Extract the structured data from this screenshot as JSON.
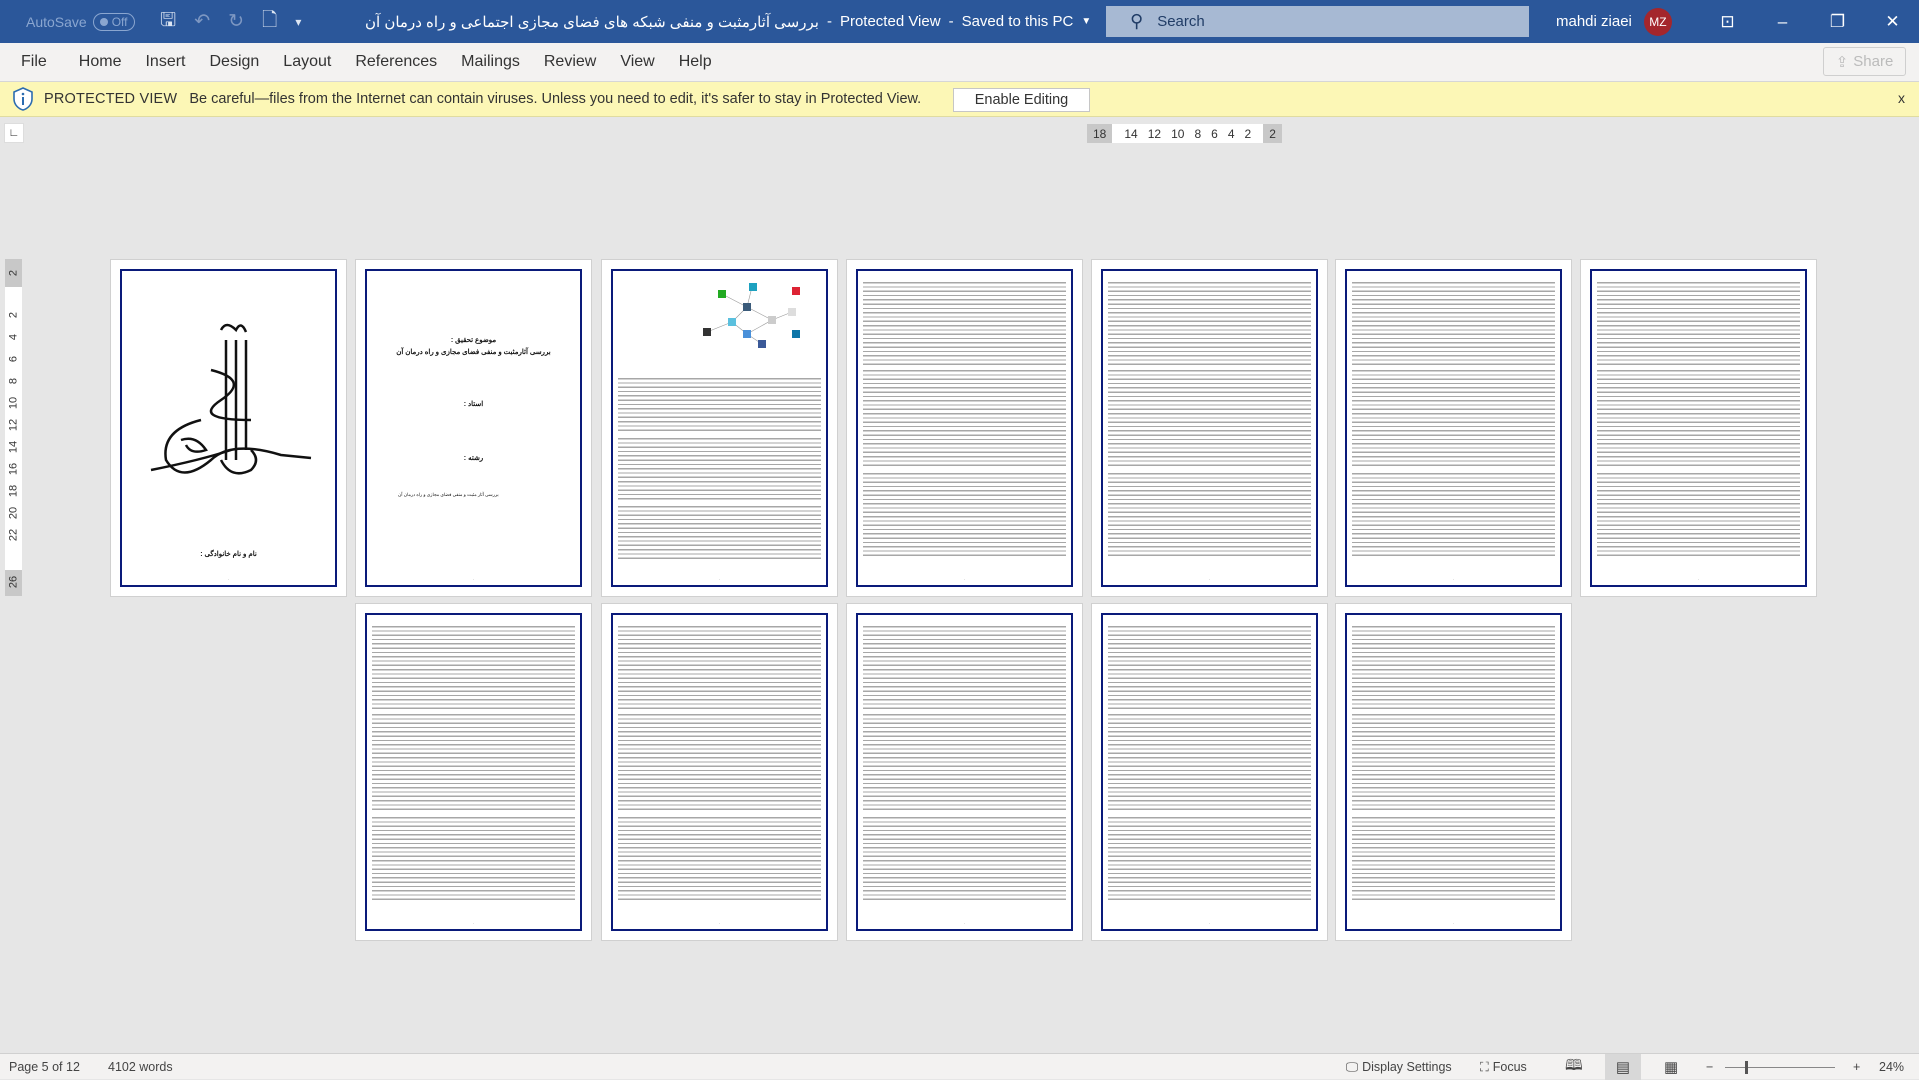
{
  "titlebar": {
    "autosave_label": "AutoSave",
    "autosave_state": "Off",
    "doc_title": "بررسی آثارمثبت و منفی شبکه های فضای مجازی اجتماعی و راه درمان آن",
    "mode": "Protected View",
    "saved": "Saved to this PC",
    "search_placeholder": "Search",
    "user_name": "mahdi ziaei",
    "user_initials": "MZ"
  },
  "menu": {
    "items": [
      "File",
      "Home",
      "Insert",
      "Design",
      "Layout",
      "References",
      "Mailings",
      "Review",
      "View",
      "Help"
    ],
    "share": "Share"
  },
  "protected": {
    "title": "PROTECTED VIEW",
    "message": "Be careful—files from the Internet can contain viruses. Unless you need to edit, it's safer to stay in Protected View.",
    "enable": "Enable Editing",
    "close": "x"
  },
  "hruler": {
    "left": "18",
    "ticks": [
      "14",
      "12",
      "10",
      "8",
      "6",
      "4",
      "2"
    ],
    "right": "2"
  },
  "vruler": {
    "top": "2",
    "ticks": [
      "2",
      "4",
      "6",
      "8",
      "10",
      "12",
      "14",
      "16",
      "18",
      "20",
      "22"
    ],
    "bottom": "26"
  },
  "pages": {
    "p1": {
      "name_label": "نام و نام خانوادگی :"
    },
    "p2": {
      "topic_label": "موضوع تحقیق :",
      "topic": "بررسی آثارمثبت و منفی فضای مجازی  و راه درمان آن",
      "teacher": "استاد :",
      "field": "رشته :",
      "footer": "بررسی آثار مثبت و منفی فضای مجازی و راه درمان آن"
    }
  },
  "status": {
    "page": "Page 5 of 12",
    "words": "4102 words",
    "display_settings": "Display Settings",
    "focus": "Focus",
    "zoom": "24%",
    "zoom_percent": 24
  }
}
